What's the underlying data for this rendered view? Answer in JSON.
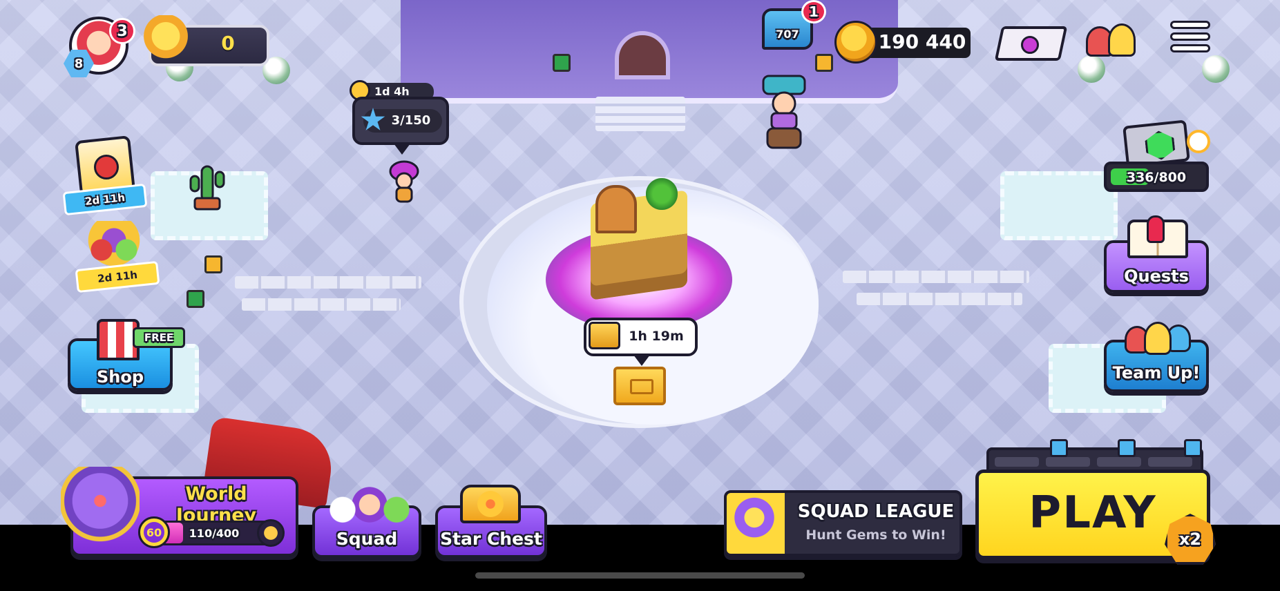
{
  "hud": {
    "notification_count": "3",
    "player_level": "8",
    "trophy_count": "0",
    "hammer_count": "707",
    "hammer_notification": "1",
    "coins": "190 440"
  },
  "task": {
    "timer": "1d 4h",
    "progress": "3/150"
  },
  "left_events": {
    "event1_timer": "2d 11h",
    "event2_timer": "2d 11h"
  },
  "shop": {
    "label": "Shop",
    "free_tag": "FREE"
  },
  "center": {
    "chest_timer": "1h 19m"
  },
  "gem_event": {
    "progress_text": "336/800",
    "progress_fraction": 0.42
  },
  "quests": {
    "label": "Quests"
  },
  "team_up": {
    "label": "Team Up!"
  },
  "world_journey": {
    "title": "World Journey",
    "level": "60",
    "progress_text": "110/400",
    "progress_fraction": 0.275
  },
  "squad": {
    "label": "Squad"
  },
  "star_chest": {
    "label": "Star Chest"
  },
  "squad_league": {
    "title": "SQUAD LEAGUE",
    "subtitle": "Hunt Gems to Win!"
  },
  "play": {
    "label": "PLAY",
    "multiplier": "x2"
  },
  "colors": {
    "play_yellow": "#ffe933",
    "panel_purple": "#9a5ef0",
    "panel_blue": "#2a9ae8",
    "badge_red": "#e8294f",
    "progress_green": "#3ecf4a"
  }
}
